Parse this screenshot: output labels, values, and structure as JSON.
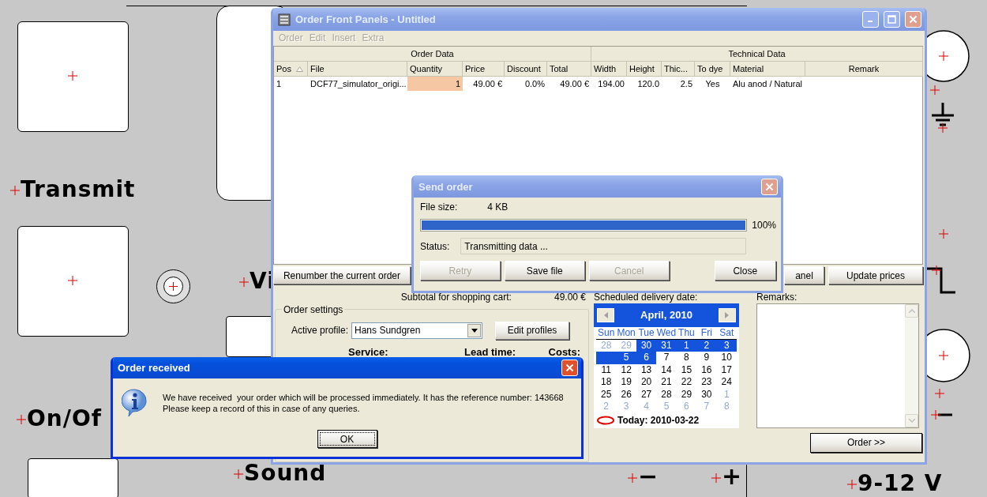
{
  "canvas": {
    "labels": [
      {
        "text": "Transmit"
      },
      {
        "text": "Vi"
      },
      {
        "text": "On/Of"
      },
      {
        "text": "Sound"
      },
      {
        "text": "−"
      },
      {
        "text": "+"
      },
      {
        "text": "9-12 V"
      }
    ]
  },
  "main_window": {
    "title": "Order Front Panels - Untitled",
    "active": false,
    "menu": [
      {
        "label": "Order",
        "disabled": true
      },
      {
        "label": "Edit",
        "disabled": true
      },
      {
        "label": "Insert",
        "disabled": true
      },
      {
        "label": "Extra",
        "disabled": true
      }
    ],
    "table": {
      "groups": [
        {
          "label": "Order Data"
        },
        {
          "label": "Technical Data"
        }
      ],
      "columns": [
        {
          "label": "Pos",
          "sorted": true
        },
        {
          "label": "File",
          "sorted": false
        },
        {
          "label": "Quantity",
          "sorted": false
        },
        {
          "label": "Price",
          "sorted": false
        },
        {
          "label": "Discount",
          "sorted": false
        },
        {
          "label": "Total",
          "sorted": false
        },
        {
          "label": "Width",
          "sorted": false
        },
        {
          "label": "Height",
          "sorted": false
        },
        {
          "label": "Thic...",
          "sorted": false
        },
        {
          "label": "To dye",
          "sorted": false
        },
        {
          "label": "Material",
          "sorted": false
        },
        {
          "label": "Remark",
          "sorted": false
        }
      ],
      "rows": [
        {
          "cells": [
            {
              "text": "1",
              "selected": false
            },
            {
              "text": "DCF77_simulator_origi...",
              "selected": false
            },
            {
              "text": "1",
              "selected": true
            },
            {
              "text": "49.00 €",
              "selected": false
            },
            {
              "text": "0.0%",
              "selected": false
            },
            {
              "text": "49.00 €",
              "selected": false
            },
            {
              "text": "194.00",
              "selected": false
            },
            {
              "text": "120.0",
              "selected": false
            },
            {
              "text": "2.5",
              "selected": false
            },
            {
              "text": "Yes",
              "selected": false
            },
            {
              "text": "Alu anod / Natural",
              "selected": false
            }
          ]
        }
      ]
    },
    "buttons_left": [
      {
        "label": "Renumber the current order"
      }
    ],
    "buttons_right": [
      {
        "label": "anel"
      },
      {
        "label": "Update prices"
      }
    ],
    "subtotal": {
      "label": "Subtotal for shopping cart:",
      "value": "49.00 €"
    },
    "order_settings": {
      "title": "Order settings",
      "profile_label": "Active profile:",
      "profile": "Hans Sundgren",
      "edit_button": "Edit profiles",
      "headers": [
        "Service:",
        "Lead time:",
        "Costs:"
      ]
    },
    "delivery": {
      "label": "Scheduled delivery date:",
      "calendar": {
        "month": "April, 2010",
        "weekdays": [
          "Sun",
          "Mon",
          "Tue",
          "Wed",
          "Thu",
          "Fri",
          "Sat"
        ],
        "weeks": [
          [
            {
              "kind": "day",
              "day": "28",
              "muted": true,
              "selected": false
            },
            {
              "kind": "day",
              "day": "29",
              "muted": true,
              "selected": false
            },
            {
              "kind": "day",
              "day": "30",
              "muted": false,
              "selected": true
            },
            {
              "kind": "day",
              "day": "31",
              "muted": false,
              "selected": true
            },
            {
              "kind": "day",
              "day": "1",
              "muted": false,
              "selected": true
            },
            {
              "kind": "day",
              "day": "2",
              "muted": false,
              "selected": true
            },
            {
              "kind": "day",
              "day": "3",
              "muted": false,
              "selected": true
            }
          ],
          [
            {
              "kind": "blank",
              "selected": true
            },
            {
              "kind": "day",
              "day": "5",
              "muted": false,
              "selected": true
            },
            {
              "kind": "day",
              "day": "6",
              "muted": false,
              "selected": true
            },
            {
              "kind": "day",
              "day": "7",
              "muted": false,
              "selected": false
            },
            {
              "kind": "day",
              "day": "8",
              "muted": false,
              "selected": false
            },
            {
              "kind": "day",
              "day": "9",
              "muted": false,
              "selected": false
            },
            {
              "kind": "day",
              "day": "10",
              "muted": false,
              "selected": false
            }
          ],
          [
            {
              "kind": "day",
              "day": "11",
              "muted": false,
              "selected": false
            },
            {
              "kind": "day",
              "day": "12",
              "muted": false,
              "selected": false
            },
            {
              "kind": "day",
              "day": "13",
              "muted": false,
              "selected": false
            },
            {
              "kind": "day",
              "day": "14",
              "muted": false,
              "selected": false
            },
            {
              "kind": "day",
              "day": "15",
              "muted": false,
              "selected": false
            },
            {
              "kind": "day",
              "day": "16",
              "muted": false,
              "selected": false
            },
            {
              "kind": "day",
              "day": "17",
              "muted": false,
              "selected": false
            }
          ],
          [
            {
              "kind": "day",
              "day": "18",
              "muted": false,
              "selected": false
            },
            {
              "kind": "day",
              "day": "19",
              "muted": false,
              "selected": false
            },
            {
              "kind": "day",
              "day": "20",
              "muted": false,
              "selected": false
            },
            {
              "kind": "day",
              "day": "21",
              "muted": false,
              "selected": false
            },
            {
              "kind": "day",
              "day": "22",
              "muted": false,
              "selected": false
            },
            {
              "kind": "day",
              "day": "23",
              "muted": false,
              "selected": false
            },
            {
              "kind": "day",
              "day": "24",
              "muted": false,
              "selected": false
            }
          ],
          [
            {
              "kind": "day",
              "day": "25",
              "muted": false,
              "selected": false
            },
            {
              "kind": "day",
              "day": "26",
              "muted": false,
              "selected": false
            },
            {
              "kind": "day",
              "day": "27",
              "muted": false,
              "selected": false
            },
            {
              "kind": "day",
              "day": "28",
              "muted": false,
              "selected": false
            },
            {
              "kind": "day",
              "day": "29",
              "muted": false,
              "selected": false
            },
            {
              "kind": "day",
              "day": "30",
              "muted": false,
              "selected": false
            },
            {
              "kind": "day",
              "day": "1",
              "muted": true,
              "selected": false
            }
          ],
          [
            {
              "kind": "day",
              "day": "2",
              "muted": true,
              "selected": false
            },
            {
              "kind": "day",
              "day": "3",
              "muted": true,
              "selected": false
            },
            {
              "kind": "day",
              "day": "4",
              "muted": true,
              "selected": false
            },
            {
              "kind": "day",
              "day": "5",
              "muted": true,
              "selected": false
            },
            {
              "kind": "day",
              "day": "6",
              "muted": true,
              "selected": false
            },
            {
              "kind": "day",
              "day": "7",
              "muted": true,
              "selected": false
            },
            {
              "kind": "day",
              "day": "8",
              "muted": true,
              "selected": false
            }
          ]
        ],
        "today": "Today: 2010-03-22"
      }
    },
    "remarks": {
      "label": "Remarks:"
    },
    "order_button": "Order >>"
  },
  "send_dialog": {
    "title": "Send order",
    "active": false,
    "file_size_label": "File size:",
    "file_size": "4 KB",
    "level": 1.0,
    "percent": "100%",
    "status_label": "Status:",
    "status": "Transmitting data ...",
    "buttons": [
      {
        "label": "Retry",
        "disabled": true
      },
      {
        "label": "Save file",
        "disabled": false
      },
      {
        "label": "Cancel",
        "disabled": true
      },
      {
        "label": "Close",
        "disabled": false
      }
    ]
  },
  "message_dialog": {
    "title": "Order received",
    "active": true,
    "lines": [
      "We have received  your order which will be processed immediately. It has the reference number: 143668",
      "Please keep a record of this in case of any queries."
    ],
    "button": "OK"
  }
}
